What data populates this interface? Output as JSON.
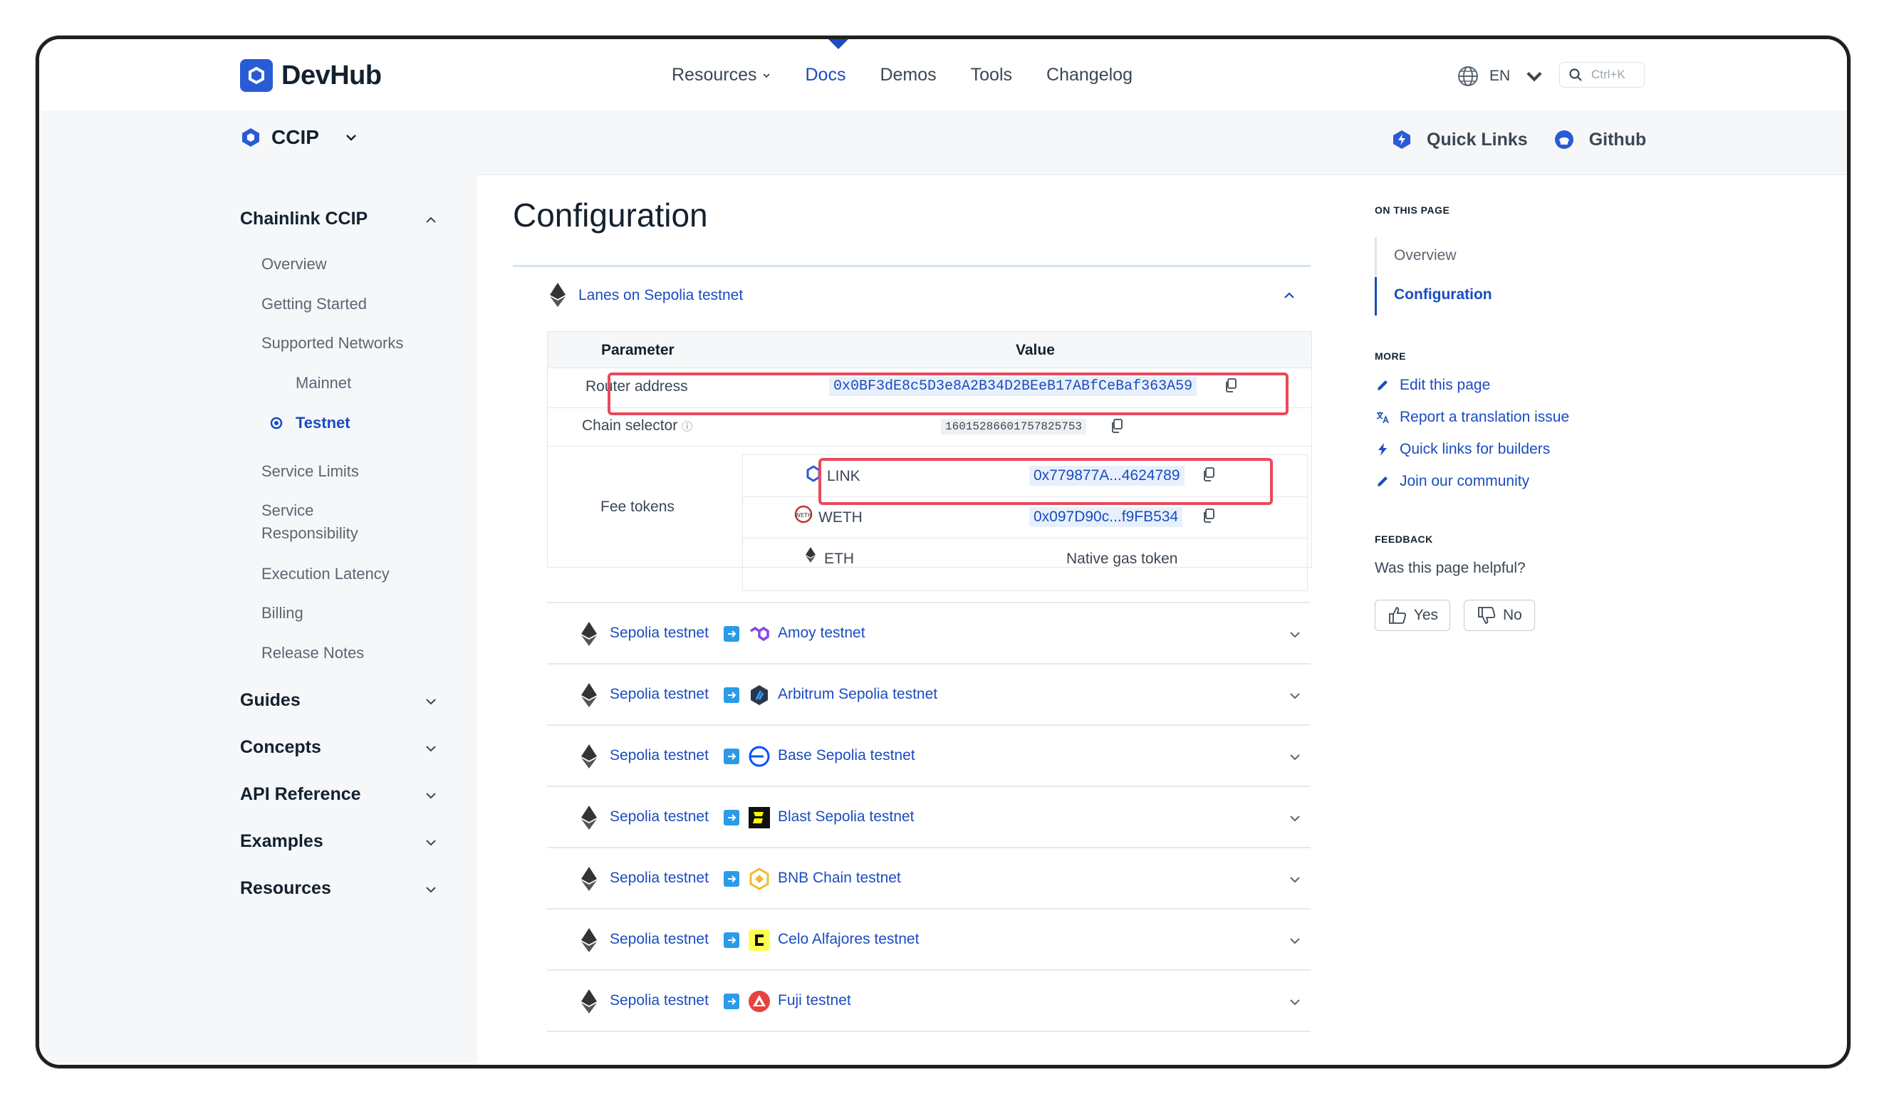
{
  "app": {
    "logo_text": "DevHub"
  },
  "topnav": {
    "items": [
      {
        "label": "Resources",
        "dropdown": true
      },
      {
        "label": "Docs",
        "active": true
      },
      {
        "label": "Demos"
      },
      {
        "label": "Tools"
      },
      {
        "label": "Changelog"
      }
    ],
    "lang": "EN",
    "search_placeholder": "Ctrl+K"
  },
  "subbar": {
    "product": "CCIP",
    "quick_links": "Quick Links",
    "github": "Github"
  },
  "sidebar": {
    "section": "Chainlink CCIP",
    "items": [
      "Overview",
      "Getting Started",
      "Supported Networks",
      "Mainnet",
      "Testnet",
      "Service Limits",
      "Service",
      "Responsibility",
      "Execution Latency",
      "Billing",
      "Release Notes"
    ],
    "groups": [
      "Guides",
      "Concepts",
      "API Reference",
      "Examples",
      "Resources"
    ]
  },
  "main": {
    "title": "Configuration",
    "lane_header": "Lanes on Sepolia testnet",
    "table": {
      "col_param": "Parameter",
      "col_value": "Value",
      "router_label": "Router address",
      "router_value": "0x0BF3dE8c5D3e8A2B34D2BEeB17ABfCeBaf363A59",
      "chain_selector_label": "Chain selector",
      "chain_selector_info": "ⓘ",
      "chain_selector_value": "16015286601757825753",
      "fee_tokens_label": "Fee tokens",
      "fee_tokens": [
        {
          "symbol": "LINK",
          "value": "0x779877A...4624789"
        },
        {
          "symbol": "WETH",
          "value": "0x097D90c...f9FB534"
        },
        {
          "symbol": "ETH",
          "value": "Native gas token"
        }
      ]
    },
    "lanes": [
      {
        "src": "Sepolia testnet",
        "dst": "Amoy testnet",
        "icon": "polygon-icon"
      },
      {
        "src": "Sepolia testnet",
        "dst": "Arbitrum Sepolia testnet",
        "icon": "arbitrum-icon"
      },
      {
        "src": "Sepolia testnet",
        "dst": "Base Sepolia testnet",
        "icon": "base-icon"
      },
      {
        "src": "Sepolia testnet",
        "dst": "Blast Sepolia testnet",
        "icon": "blast-icon"
      },
      {
        "src": "Sepolia testnet",
        "dst": "BNB Chain testnet",
        "icon": "bnb-icon"
      },
      {
        "src": "Sepolia testnet",
        "dst": "Celo Alfajores testnet",
        "icon": "celo-icon"
      },
      {
        "src": "Sepolia testnet",
        "dst": "Fuji testnet",
        "icon": "avalanche-icon"
      }
    ]
  },
  "toc": {
    "on_this_page": "ON THIS PAGE",
    "items": [
      "Overview",
      "Configuration"
    ],
    "more_label": "MORE",
    "more": [
      "Edit this page",
      "Report a translation issue",
      "Quick links for builders",
      "Join our community"
    ],
    "feedback_label": "FEEDBACK",
    "feedback_q": "Was this page helpful?",
    "yes": "Yes",
    "no": "No"
  },
  "colors": {
    "accent": "#1a4cc0",
    "highlight": "#e8495c",
    "sidebar_bg": "#f5f7f9"
  }
}
